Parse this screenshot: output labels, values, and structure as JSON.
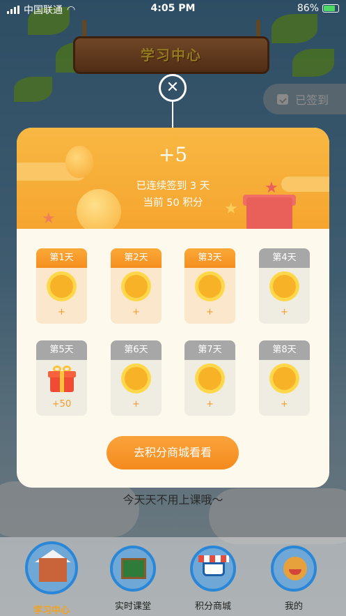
{
  "status_bar": {
    "carrier": "中国联通",
    "time": "4:05 PM",
    "battery": "86%"
  },
  "header": {
    "title": "学习中心",
    "checked_label": "已签到"
  },
  "modal": {
    "plus": "+5",
    "streak_text": "已连续签到 3 天",
    "points_text": "当前 50 积分",
    "days": [
      {
        "label": "第1天",
        "reward": "+"
      },
      {
        "label": "第2天",
        "reward": "+"
      },
      {
        "label": "第3天",
        "reward": "+"
      },
      {
        "label": "第4天",
        "reward": "+"
      },
      {
        "label": "第5天",
        "reward": "+50"
      },
      {
        "label": "第6天",
        "reward": "+"
      },
      {
        "label": "第7天",
        "reward": "+"
      },
      {
        "label": "第8天",
        "reward": "+"
      }
    ],
    "cta": "去积分商城看看"
  },
  "notice": "今天天不用上课哦～",
  "nav": [
    {
      "label": "学习中心"
    },
    {
      "label": "实时课堂"
    },
    {
      "label": "积分商城"
    },
    {
      "label": "我的"
    }
  ],
  "colors": {
    "accent": "#f5a21c",
    "active_card": "#fbe8cc",
    "inactive_label": "#a7a7a7"
  }
}
